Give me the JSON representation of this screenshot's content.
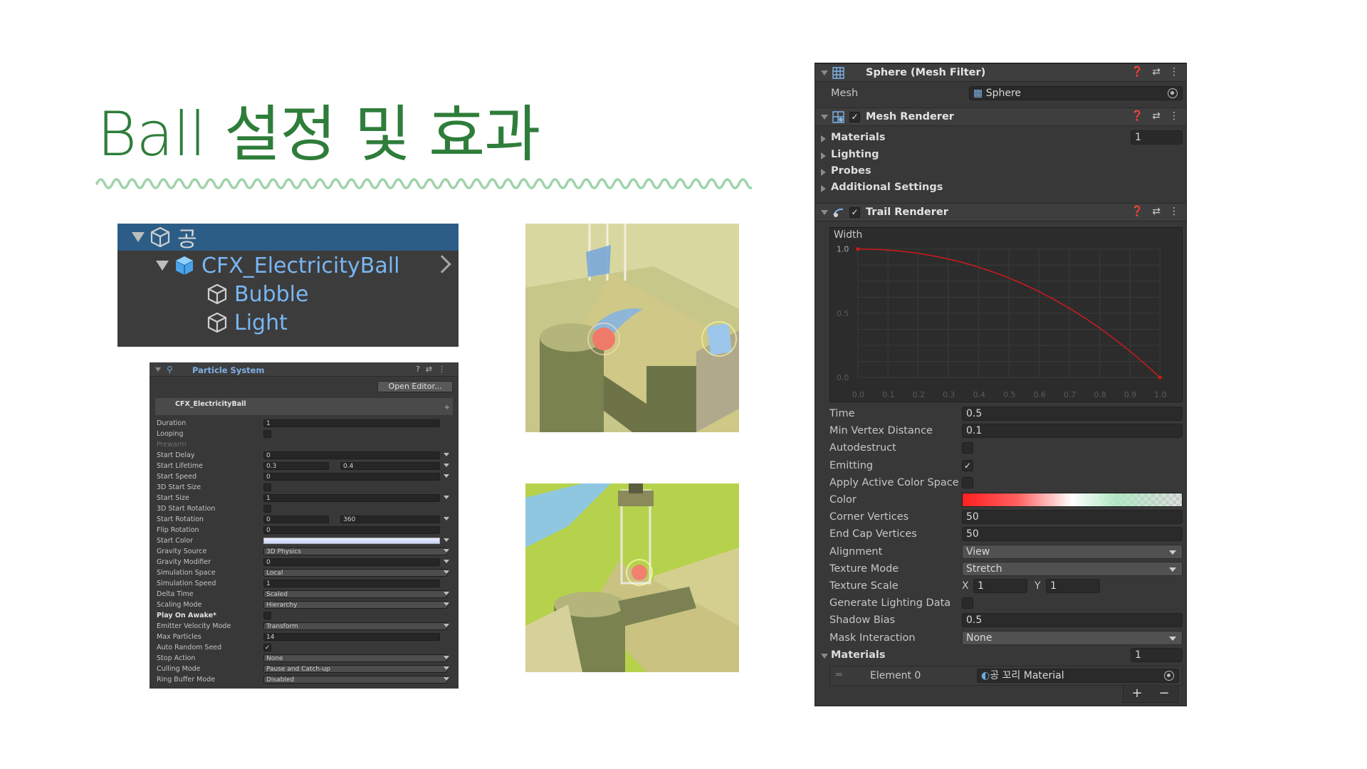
{
  "slide": {
    "title": "Ball 설정 및 효과",
    "accent_color": "#2e7d3a",
    "wave_color": "#9fd4a8"
  },
  "hierarchy": {
    "rows": [
      {
        "label": "공",
        "expanded": true,
        "selected": true,
        "icon": "cube-icon"
      },
      {
        "label": "CFX_ElectricityBall",
        "expanded": true,
        "prefab": true,
        "icon": "prefab-cube-icon"
      },
      {
        "label": "Bubble",
        "icon": "cube-icon"
      },
      {
        "label": "Light",
        "icon": "cube-icon"
      }
    ]
  },
  "particle_system": {
    "title": "Particle System",
    "open_editor": "Open Editor...",
    "module_name": "CFX_ElectricityBall",
    "props": [
      {
        "label": "Duration",
        "value": "1"
      },
      {
        "label": "Looping",
        "checkbox": false
      },
      {
        "label": "Prewarm",
        "dim": true
      },
      {
        "label": "Start Delay",
        "value": "0"
      },
      {
        "label": "Start Lifetime",
        "value": "0.3",
        "value2": "0.4"
      },
      {
        "label": "Start Speed",
        "value": "0"
      },
      {
        "label": "3D Start Size",
        "checkbox": false
      },
      {
        "label": "Start Size",
        "value": "1"
      },
      {
        "label": "3D Start Rotation",
        "checkbox": false
      },
      {
        "label": "Start Rotation",
        "value": "0",
        "value2": "360"
      },
      {
        "label": "Flip Rotation",
        "value": "0"
      },
      {
        "label": "Start Color",
        "color": true
      },
      {
        "label": "Gravity Source",
        "value": "3D Physics",
        "dropdown": true
      },
      {
        "label": "Gravity Modifier",
        "value": "0"
      },
      {
        "label": "Simulation Space",
        "value": "Local",
        "dropdown": true
      },
      {
        "label": "Simulation Speed",
        "value": "1"
      },
      {
        "label": "Delta Time",
        "value": "Scaled",
        "dropdown": true
      },
      {
        "label": "Scaling Mode",
        "value": "Hierarchy",
        "dropdown": true
      },
      {
        "label": "Play On Awake*",
        "checkbox": false,
        "bold": true
      },
      {
        "label": "Emitter Velocity Mode",
        "value": "Transform",
        "dropdown": true
      },
      {
        "label": "Max Particles",
        "value": "14"
      },
      {
        "label": "Auto Random Seed",
        "checkbox": true
      },
      {
        "label": "Stop Action",
        "value": "None",
        "dropdown": true
      },
      {
        "label": "Culling Mode",
        "value": "Pause and Catch-up",
        "dropdown": true
      },
      {
        "label": "Ring Buffer Mode",
        "value": "Disabled",
        "dropdown": true
      }
    ]
  },
  "inspector": {
    "mesh_filter": {
      "name": "Sphere (Mesh Filter)",
      "mesh_label": "Mesh",
      "mesh_value": "Sphere"
    },
    "mesh_renderer": {
      "name": "Mesh Renderer",
      "enabled": true,
      "sections": [
        "Materials",
        "Lighting",
        "Probes",
        "Additional Settings"
      ],
      "materials_count": "1"
    },
    "trail_renderer": {
      "name": "Trail Renderer",
      "enabled": true,
      "width_label": "Width",
      "curve_y_ticks": [
        "1.0",
        "0.5",
        "0.0"
      ],
      "curve_x_ticks": [
        "0.0",
        "0.1",
        "0.2",
        "0.3",
        "0.4",
        "0.5",
        "0.6",
        "0.7",
        "0.8",
        "0.9",
        "1.0"
      ],
      "width_curve": [
        {
          "t": 0.0,
          "w": 1.0
        },
        {
          "t": 0.5,
          "w": 0.8
        },
        {
          "t": 1.0,
          "w": 0.0
        }
      ],
      "curve_color": "#d01a1a",
      "time_label": "Time",
      "time": "0.5",
      "min_vertex_label": "Min Vertex Distance",
      "min_vertex": "0.1",
      "autodestruct_label": "Autodestruct",
      "autodestruct": false,
      "emitting_label": "Emitting",
      "emitting": true,
      "apply_active_label": "Apply Active Color Space",
      "apply_active": false,
      "color_label": "Color",
      "corner_label": "Corner Vertices",
      "corner": "50",
      "endcap_label": "End Cap Vertices",
      "endcap": "50",
      "alignment_label": "Alignment",
      "alignment": "View",
      "texture_mode_label": "Texture Mode",
      "texture_mode": "Stretch",
      "texture_scale_label": "Texture Scale",
      "ts_x_label": "X",
      "ts_x": "1",
      "ts_y_label": "Y",
      "ts_y": "1",
      "gen_lighting_label": "Generate Lighting Data",
      "gen_lighting": false,
      "shadow_bias_label": "Shadow Bias",
      "shadow_bias": "0.5",
      "mask_label": "Mask Interaction",
      "mask": "None",
      "materials_label": "Materials",
      "materials_count": "1",
      "element_label": "Element 0",
      "element_value": "공 꼬리 Material",
      "add_button": "+",
      "remove_button": "−"
    }
  }
}
